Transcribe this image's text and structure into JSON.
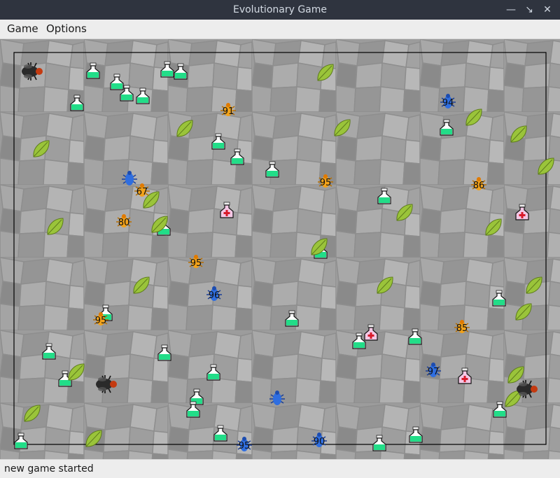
{
  "window": {
    "title": "Evolutionary Game"
  },
  "menu": {
    "game": "Game",
    "options": "Options"
  },
  "status": {
    "message": "new game started"
  },
  "colors": {
    "arena_bg": "#9a9a9a",
    "potion_green": "#22dd88",
    "potion_pink": "#f0a8d8",
    "leaf_green": "#9ac43a",
    "bug_orange": "#f2a21a",
    "bug_blue": "#2f6ee0",
    "bug_black": "#222222"
  },
  "icons": {
    "potion": "green-potion-icon",
    "health": "health-potion-icon",
    "leaf": "leaf-icon",
    "bug": "bug-icon"
  },
  "creatures": {
    "orange": [
      {
        "label": "91"
      },
      {
        "label": "95"
      },
      {
        "label": "86"
      },
      {
        "label": "67"
      },
      {
        "label": "80"
      },
      {
        "label": "95"
      },
      {
        "label": "95"
      },
      {
        "label": "85"
      }
    ],
    "blue": [
      {
        "label": "94"
      },
      {
        "label": ""
      },
      {
        "label": "96"
      },
      {
        "label": "97"
      },
      {
        "label": ""
      },
      {
        "label": "95"
      },
      {
        "label": "90"
      }
    ],
    "black": [
      {
        "label": ""
      },
      {
        "label": ""
      },
      {
        "label": ""
      }
    ]
  }
}
